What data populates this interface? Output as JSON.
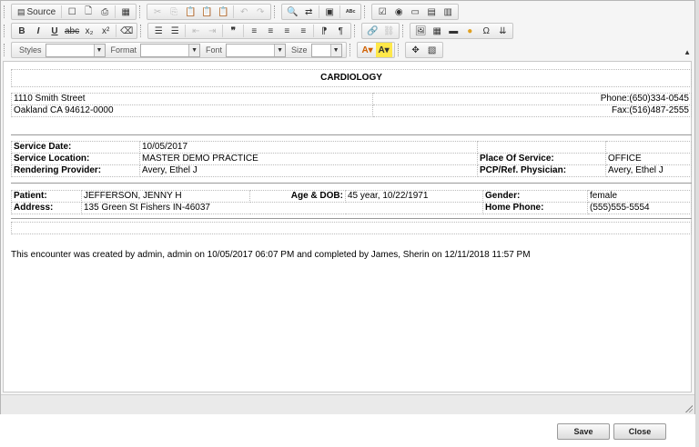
{
  "toolbar": {
    "row1": {
      "source_label": "Source"
    },
    "row3": {
      "styles_label": "Styles",
      "format_label": "Format",
      "font_label": "Font",
      "size_label": "Size"
    }
  },
  "doc": {
    "title": "CARDIOLOGY",
    "address_line1": "1110 Smith Street",
    "address_line2": "Oakland CA 94612-0000",
    "phone": "Phone:(650)334-0545",
    "fax": "Fax:(516)487-2555",
    "service": {
      "date_label": "Service Date:",
      "date_value": "10/05/2017",
      "location_label": "Service Location:",
      "location_value": "MASTER DEMO PRACTICE",
      "place_label": "Place Of Service:",
      "place_value": "OFFICE",
      "provider_label": "Rendering Provider:",
      "provider_value": "Avery, Ethel J",
      "pcp_label": "PCP/Ref. Physician:",
      "pcp_value": "Avery, Ethel J"
    },
    "patient": {
      "patient_label": "Patient:",
      "patient_value": "JEFFERSON, JENNY H",
      "age_label": "Age & DOB:",
      "age_value": "45 year, 10/22/1971",
      "gender_label": "Gender:",
      "gender_value": "female",
      "address_label": "Address:",
      "address_value": "135 Green St Fishers IN-46037",
      "phone_label": "Home Phone:",
      "phone_value": "(555)555-5554"
    },
    "footer": "This encounter was created by admin, admin on 10/05/2017 06:07 PM and completed by James, Sherin on 12/11/2018 11:57 PM"
  },
  "actions": {
    "save": "Save",
    "close": "Close"
  }
}
